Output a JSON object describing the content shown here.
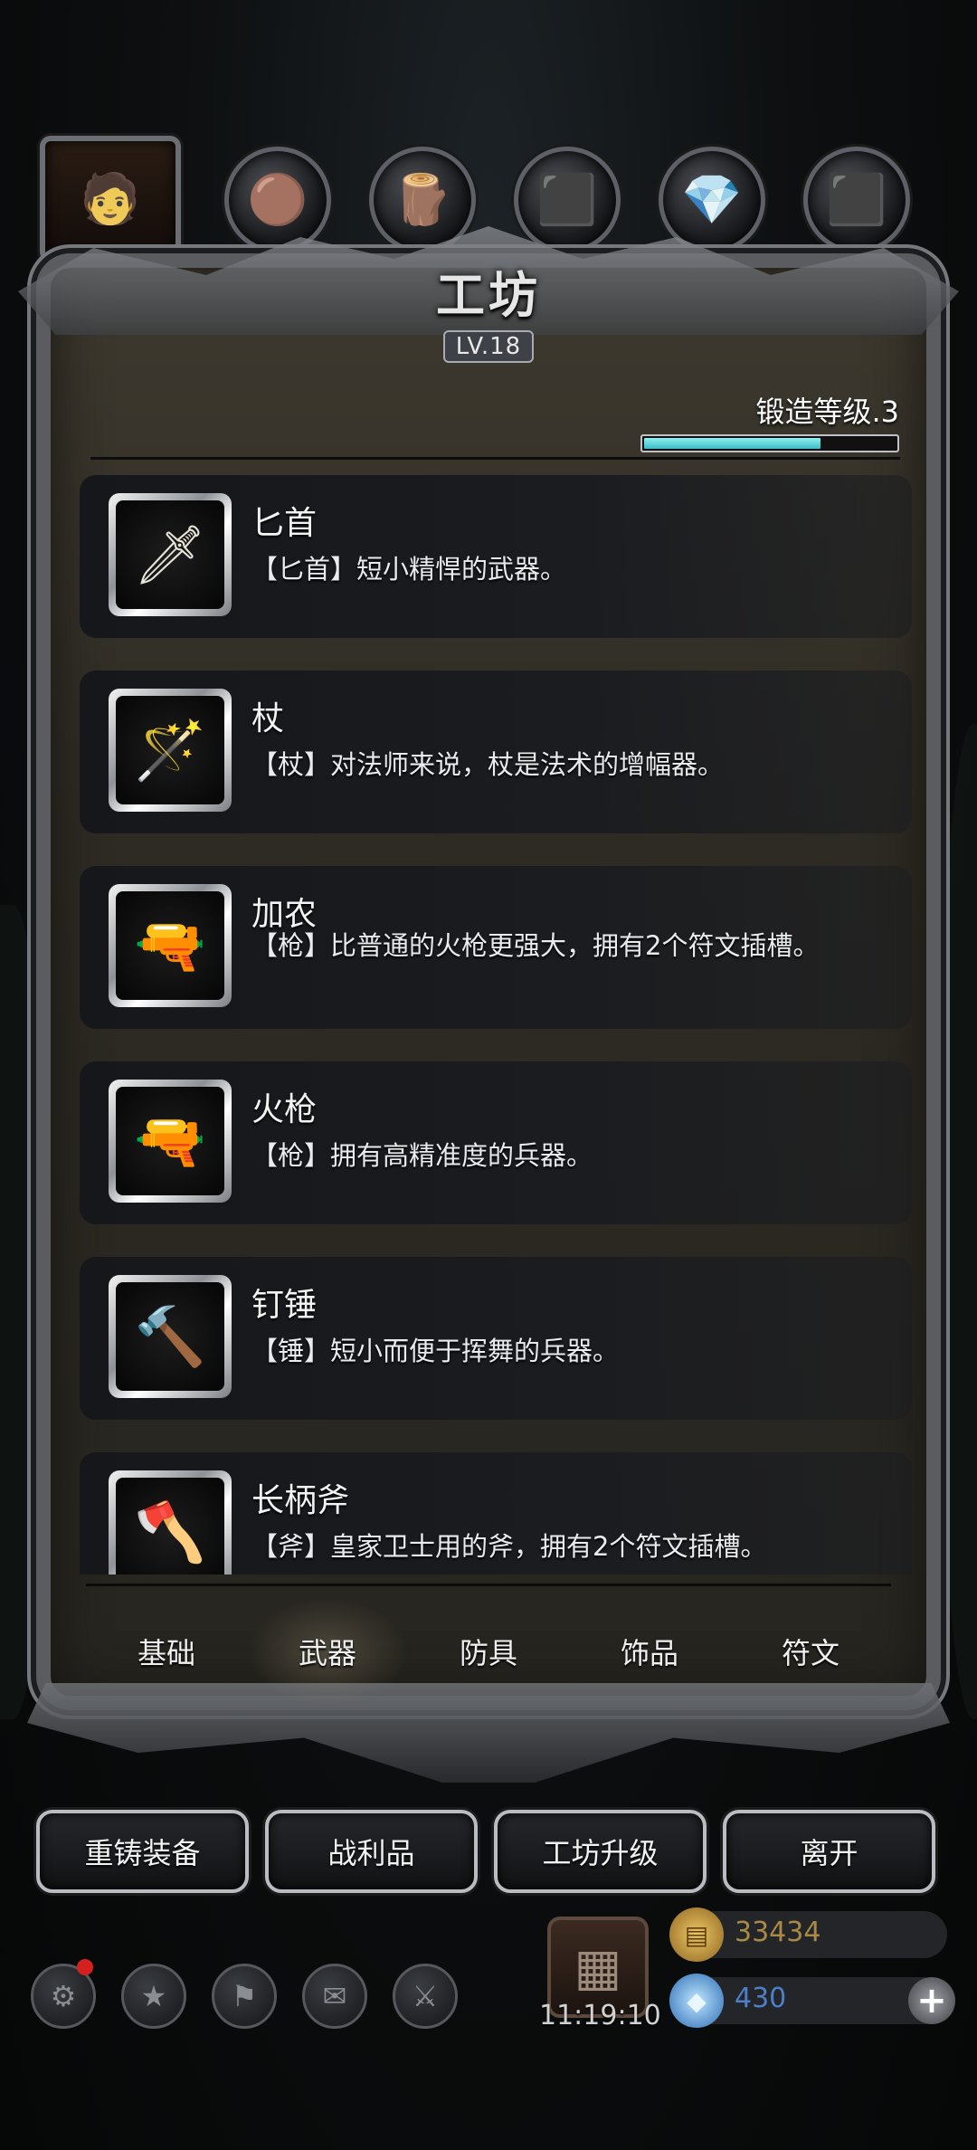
{
  "header": {
    "title": "工坊",
    "level": "LV.18",
    "forge_level_label": "锻造等级.3",
    "forge_progress": 0.7
  },
  "top_tabs": [
    {
      "icon": "crafter-portrait-icon",
      "glyph": "🧑"
    },
    {
      "icon": "leather-material-icon",
      "glyph": "🟤"
    },
    {
      "icon": "wood-material-icon",
      "glyph": "🪵"
    },
    {
      "icon": "iron-material-icon",
      "glyph": "⬛"
    },
    {
      "icon": "crystal-material-icon",
      "glyph": "💎"
    },
    {
      "icon": "steel-material-icon",
      "glyph": "⬛"
    }
  ],
  "items": [
    {
      "name": "匕首",
      "desc": "【匕首】短小精悍的武器。",
      "icon": "dagger-icon",
      "glyph": "🗡"
    },
    {
      "name": "杖",
      "desc": "【杖】对法师来说，杖是法术的增幅器。",
      "icon": "staff-icon",
      "glyph": "🪄"
    },
    {
      "name": "加农",
      "desc": "【枪】比普通的火枪更强大，拥有2个符文插槽。",
      "icon": "cannon-rifle-icon",
      "glyph": "🔫"
    },
    {
      "name": "火枪",
      "desc": "【枪】拥有高精准度的兵器。",
      "icon": "pistol-icon",
      "glyph": "🔫"
    },
    {
      "name": "钉锤",
      "desc": "【锤】短小而便于挥舞的兵器。",
      "icon": "mace-icon",
      "glyph": "🔨"
    },
    {
      "name": "长柄斧",
      "desc": "【斧】皇家卫士用的斧，拥有2个符文插槽。",
      "icon": "halberd-icon",
      "glyph": "🪓"
    }
  ],
  "categories": [
    "基础",
    "武器",
    "防具",
    "饰品",
    "符文"
  ],
  "active_category": "武器",
  "actions": {
    "reforge": "重铸装备",
    "loot": "战利品",
    "upgrade": "工坊升级",
    "leave": "离开"
  },
  "hud": {
    "timer": "11:19:10",
    "gold": "33434",
    "gems": "430",
    "plus": "+",
    "icons": [
      "settings-icon",
      "achievement-icon",
      "guild-icon",
      "mail-icon",
      "battle-icon"
    ],
    "chest_icon": "gift-chest-icon"
  },
  "colors": {
    "gold_text": "#a88a46",
    "gem_text": "#4d7fc7",
    "progress_fill": "#3bbcc6"
  }
}
